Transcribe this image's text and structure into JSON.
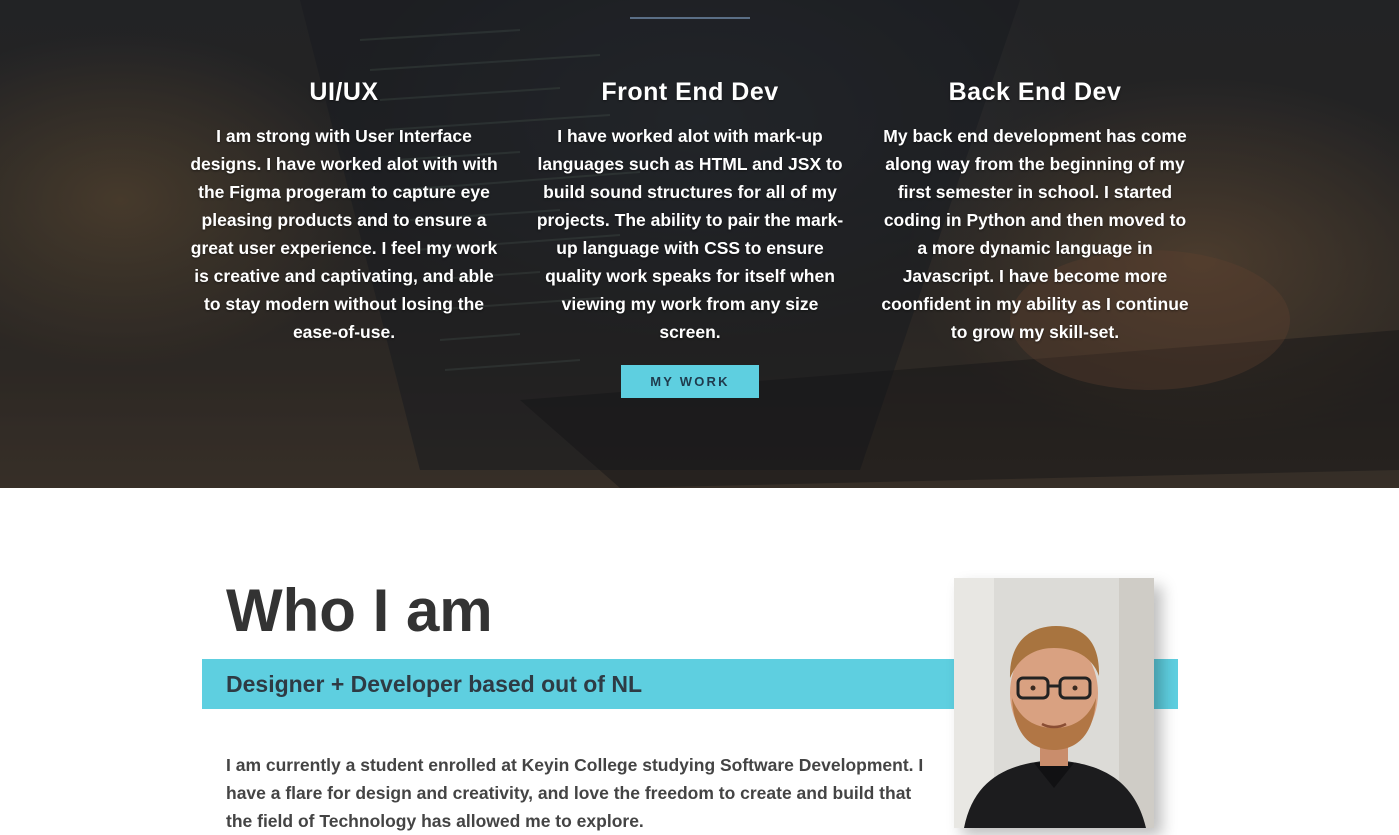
{
  "hero": {
    "columns": [
      {
        "heading": "UI/UX",
        "text": "I am strong with User Interface designs. I have worked alot with with the Figma progeram to capture eye pleasing products and to ensure a great user experience. I feel my work is creative and captivating, and able to stay modern without losing the ease-of-use."
      },
      {
        "heading": "Front End Dev",
        "text": "I have worked alot with mark-up languages such as HTML and JSX to build sound structures for all of my projects. The ability to pair the mark-up language with CSS to ensure quality work speaks for itself when viewing my work from any size screen."
      },
      {
        "heading": "Back End Dev",
        "text": "My back end development has come along way from the beginning of my first semester in school. I started coding in Python and then moved to a more dynamic language in Javascript. I have become more coonfident in my ability as I continue to grow my skill-set."
      }
    ],
    "button_label": "MY WORK"
  },
  "about": {
    "title": "Who I am",
    "tagline": "Designer + Developer based out of NL",
    "bio": "I am currently a student enrolled at Keyin College studying Software Development. I have a flare for design and creativity, and love the freedom to create and build that the field of Technology has allowed me to explore."
  },
  "colors": {
    "accent": "#5ecfe0",
    "heading_dark": "#333333",
    "hero_text": "#ffffff"
  }
}
